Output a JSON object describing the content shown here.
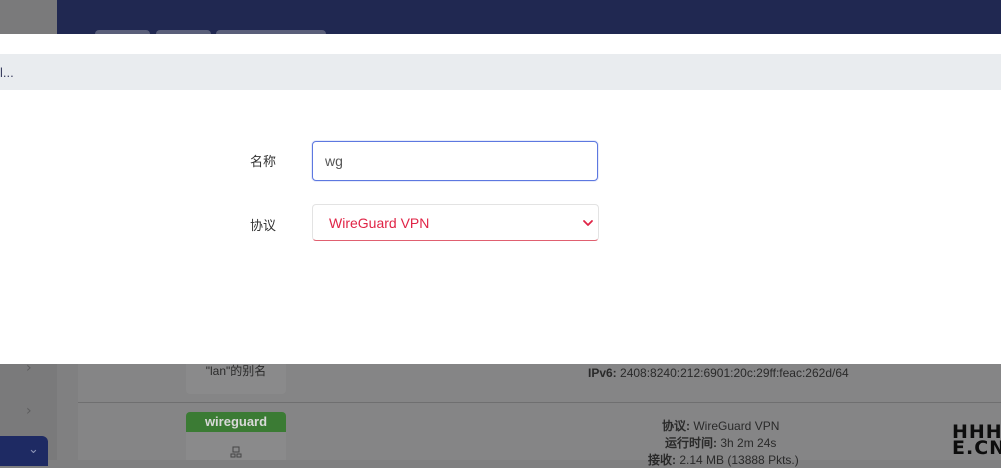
{
  "modal": {
    "title": "l...",
    "name_label": "名称",
    "name_value": "wg",
    "protocol_label": "协议",
    "protocol_selected": "WireGuard VPN"
  },
  "background": {
    "lan_alias": "\"lan\"的别名",
    "lan_ipv6_label": "IPv6:",
    "lan_ipv6_value": "2408:8240:212:6901:20c:29ff:feac:262d/64",
    "wg_tag": "wireguard",
    "wg_protocol_label": "协议:",
    "wg_protocol_value": "WireGuard VPN",
    "wg_uptime_label": "运行时间:",
    "wg_uptime_value": "3h 2m 24s",
    "wg_rx_label": "接收:",
    "wg_rx_value": "2.14 MB (13888 Pkts.)",
    "watermark_line1": "HHH",
    "watermark_line2": "E.CN"
  },
  "colors": {
    "header_bg": "#202851",
    "input_focus": "#5d78e0",
    "select_text": "#e02446",
    "tag_green": "#3b7b34"
  }
}
